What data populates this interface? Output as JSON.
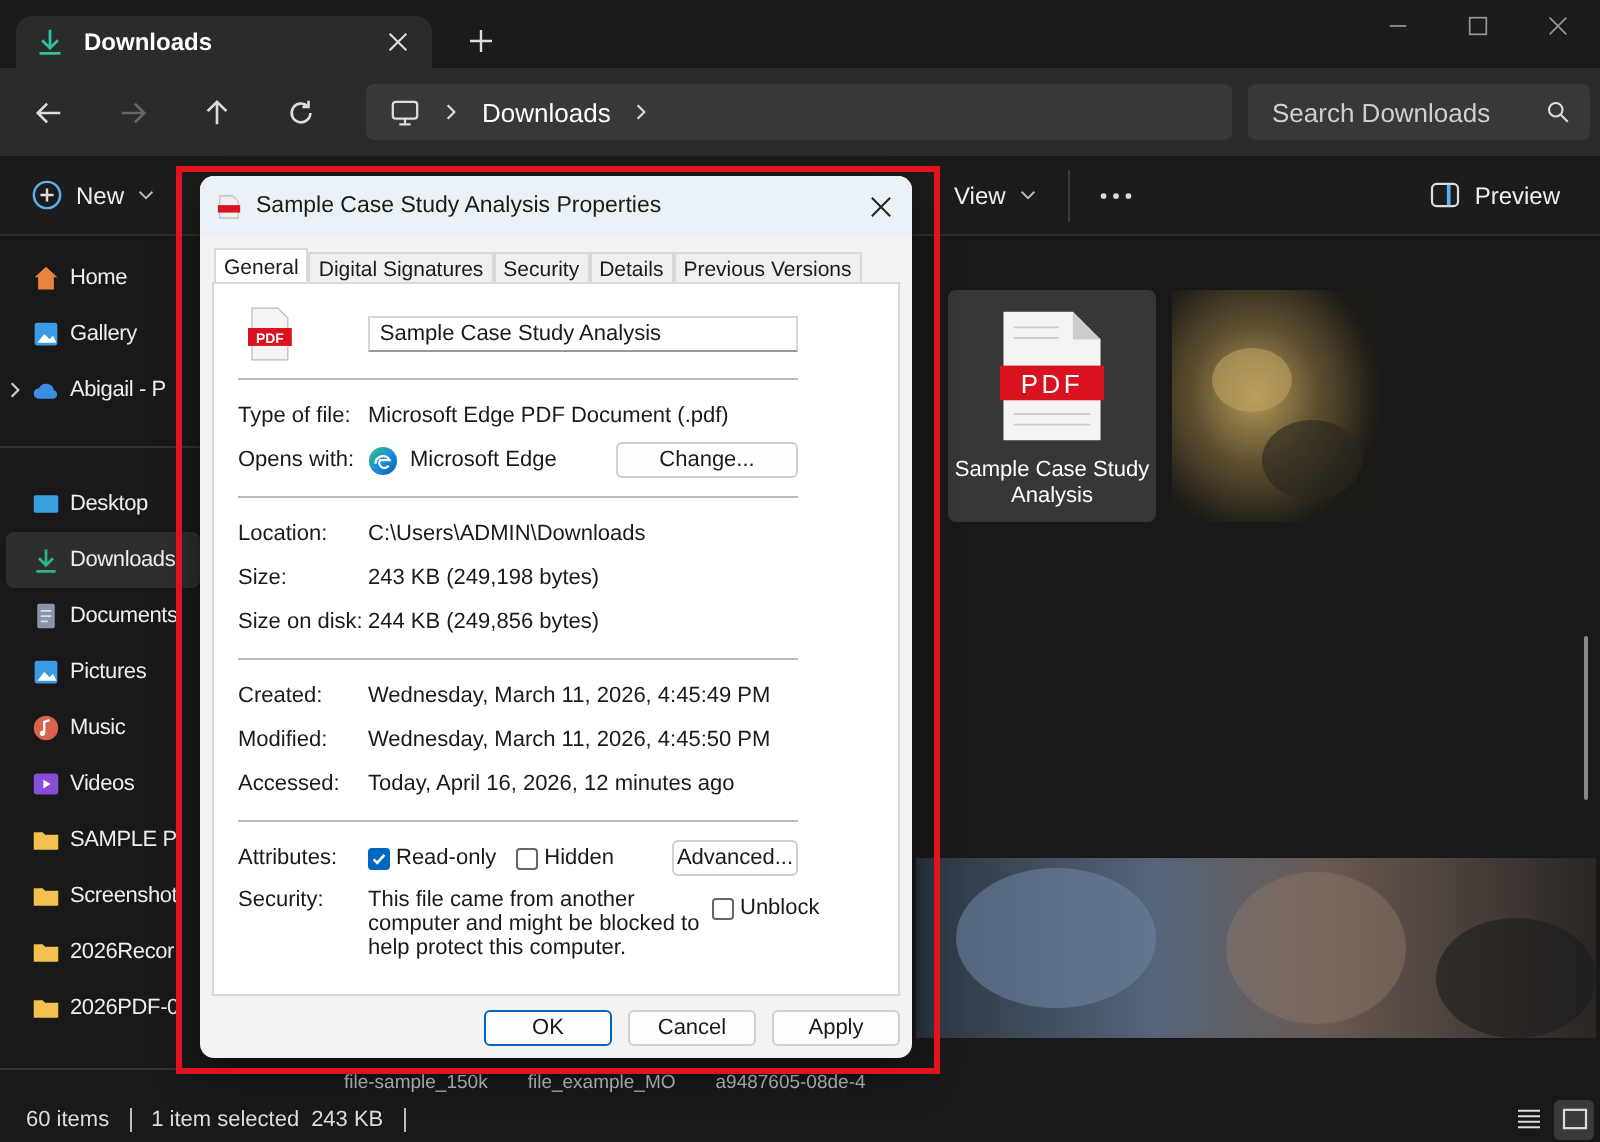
{
  "window": {
    "tab_title": "Downloads"
  },
  "address": {
    "segment": "Downloads"
  },
  "search": {
    "placeholder": "Search Downloads"
  },
  "toolbar": {
    "new": "New",
    "view": "View",
    "preview": "Preview"
  },
  "sidebar": {
    "groups": [
      [
        {
          "label": "Home",
          "kind": "home",
          "selected": false,
          "expandable": false
        },
        {
          "label": "Gallery",
          "kind": "gallery",
          "selected": false,
          "expandable": false
        },
        {
          "label": "Abigail - P",
          "kind": "cloud",
          "selected": false,
          "expandable": true
        }
      ],
      [
        {
          "label": "Desktop",
          "kind": "desktop",
          "selected": false,
          "expandable": false
        },
        {
          "label": "Downloads",
          "kind": "download",
          "selected": true,
          "expandable": false
        },
        {
          "label": "Documents",
          "kind": "document",
          "selected": false,
          "expandable": false
        },
        {
          "label": "Pictures",
          "kind": "pictures",
          "selected": false,
          "expandable": false
        },
        {
          "label": "Music",
          "kind": "music",
          "selected": false,
          "expandable": false
        },
        {
          "label": "Videos",
          "kind": "videos",
          "selected": false,
          "expandable": false
        },
        {
          "label": "SAMPLE P",
          "kind": "folder",
          "selected": false,
          "expandable": false
        },
        {
          "label": "Screenshot",
          "kind": "folder",
          "selected": false,
          "expandable": false
        },
        {
          "label": "2026Recor",
          "kind": "folder",
          "selected": false,
          "expandable": false
        },
        {
          "label": "2026PDF-0",
          "kind": "folder",
          "selected": false,
          "expandable": false
        }
      ]
    ]
  },
  "files": [
    {
      "name": "Sample Case Study Analysis",
      "kind": "pdf",
      "icon_label": "PDF",
      "selected": true
    },
    {
      "kind": "picture",
      "selected": false
    }
  ],
  "partial_file_names": [
    "file-sample_150k",
    "file_example_MO",
    "a9487605-08de-4"
  ],
  "status_bar": {
    "count": "60 items",
    "selection": "1 item selected",
    "size": "243 KB",
    "views": [
      {
        "kind": "details",
        "selected": false
      },
      {
        "kind": "tiles",
        "selected": true
      }
    ]
  },
  "dialog": {
    "title": "Sample Case Study Analysis Properties",
    "tabs": [
      {
        "label": "General",
        "selected": true
      },
      {
        "label": "Digital Signatures",
        "selected": false
      },
      {
        "label": "Security",
        "selected": false
      },
      {
        "label": "Details",
        "selected": false
      },
      {
        "label": "Previous Versions",
        "selected": false
      }
    ],
    "icon_label": "PDF",
    "file_name": "Sample Case Study Analysis",
    "type": {
      "label": "Type of file:",
      "value": "Microsoft Edge PDF Document (.pdf)"
    },
    "opens": {
      "label": "Opens with:",
      "value": "Microsoft Edge",
      "button": "Change..."
    },
    "location_rows": [
      {
        "label": "Location:",
        "value": "C:\\Users\\ADMIN\\Downloads"
      },
      {
        "label": "Size:",
        "value": "243 KB (249,198 bytes)"
      },
      {
        "label": "Size on disk:",
        "value": "244 KB (249,856 bytes)"
      }
    ],
    "date_rows": [
      {
        "label": "Created:",
        "value": "Wednesday, March 11, 2026, 4:45:49 PM"
      },
      {
        "label": "Modified:",
        "value": "Wednesday, March 11, 2026, 4:45:50 PM"
      },
      {
        "label": "Accessed:",
        "value": "Today, April 16, 2026, 12 minutes ago"
      }
    ],
    "attributes": {
      "label": "Attributes:",
      "checks": [
        {
          "label": "Read-only",
          "checked": true
        },
        {
          "label": "Hidden",
          "checked": false
        }
      ],
      "button": "Advanced..."
    },
    "security": {
      "label": "Security:",
      "text": "This file came from another computer and might be blocked to help protect this computer.",
      "check": {
        "label": "Unblock",
        "checked": false
      }
    },
    "buttons": [
      {
        "label": "OK",
        "default": true
      },
      {
        "label": "Cancel",
        "default": false
      },
      {
        "label": "Apply",
        "default": false
      }
    ]
  },
  "highlight": {
    "shown": true
  }
}
